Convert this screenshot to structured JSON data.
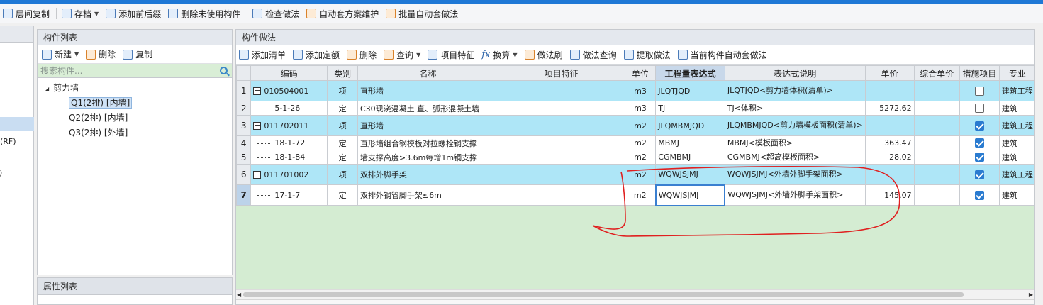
{
  "toolbar": {
    "items": [
      {
        "label": "层间复制",
        "icon": "copy-floor-icon"
      },
      {
        "label": "存档",
        "icon": "save-archive-icon",
        "dropdown": true
      },
      {
        "label": "添加前后缀",
        "icon": "add-affix-icon"
      },
      {
        "label": "删除未使用构件",
        "icon": "delete-unused-icon"
      },
      {
        "label": "检查做法",
        "icon": "check-method-icon"
      },
      {
        "label": "自动套方案维护",
        "icon": "auto-scheme-icon"
      },
      {
        "label": "批量自动套做法",
        "icon": "batch-auto-icon"
      }
    ]
  },
  "left_strip": {
    "fragment1": "(RF)",
    "fragment2": ")"
  },
  "component_list": {
    "title": "构件列表",
    "tools": {
      "new": "新建",
      "delete": "删除",
      "copy": "复制"
    },
    "search_placeholder": "搜索构件...",
    "tree": {
      "root": "剪力墙",
      "children": [
        "Q1(2排) [内墙]",
        "Q2(2排) [内墙]",
        "Q3(2排) [外墙]"
      ],
      "selected_index": 0
    }
  },
  "attribute_list": {
    "title": "属性列表"
  },
  "method_panel": {
    "title": "构件做法",
    "tools": {
      "add_list": "添加清单",
      "add_quota": "添加定额",
      "delete": "删除",
      "query": "查询",
      "item_feature": "项目特征",
      "fx": "fx",
      "convert": "换算",
      "brush": "做法刷",
      "method_query": "做法查询",
      "extract": "提取做法",
      "auto_apply": "当前构件自动套做法"
    },
    "columns": [
      "编码",
      "类别",
      "名称",
      "项目特征",
      "单位",
      "工程量表达式",
      "表达式说明",
      "单价",
      "综合单价",
      "措施项目",
      "专业"
    ],
    "active_column": "工程量表达式",
    "rows": [
      {
        "num": "1",
        "kind": "item",
        "code": "010504001",
        "cat": "项",
        "name": "直形墙",
        "feature": "",
        "unit": "m3",
        "expr": "JLQTJQD",
        "desc": "JLQTJQD<剪力墙体积(清单)>",
        "price": "",
        "comp_price": "",
        "measure": false,
        "major": "建筑工程"
      },
      {
        "num": "2",
        "kind": "sub",
        "code": "5-1-26",
        "cat": "定",
        "name": "C30现浇混凝土 直、弧形混凝土墙",
        "feature": "",
        "unit": "m3",
        "expr": "TJ",
        "desc": "TJ<体积>",
        "price": "5272.62",
        "comp_price": "",
        "measure": false,
        "major": "建筑"
      },
      {
        "num": "3",
        "kind": "item",
        "code": "011702011",
        "cat": "项",
        "name": "直形墙",
        "feature": "",
        "unit": "m2",
        "expr": "JLQMBMJQD",
        "desc": "JLQMBMJQD<剪力墙模板面积(清单)>",
        "price": "",
        "comp_price": "",
        "measure": true,
        "major": "建筑工程"
      },
      {
        "num": "4",
        "kind": "sub",
        "code": "18-1-72",
        "cat": "定",
        "name": "直形墙组合钢模板对拉螺栓钢支撑",
        "feature": "",
        "unit": "m2",
        "expr": "MBMJ",
        "desc": "MBMJ<模板面积>",
        "price": "363.47",
        "comp_price": "",
        "measure": true,
        "major": "建筑"
      },
      {
        "num": "5",
        "kind": "sub",
        "code": "18-1-84",
        "cat": "定",
        "name": "墙支撑高度>3.6m每增1m钢支撑",
        "feature": "",
        "unit": "m2",
        "expr": "CGMBMJ",
        "desc": "CGMBMJ<超高模板面积>",
        "price": "28.02",
        "comp_price": "",
        "measure": true,
        "major": "建筑"
      },
      {
        "num": "6",
        "kind": "item",
        "code": "011701002",
        "cat": "项",
        "name": "双排外脚手架",
        "feature": "",
        "unit": "m2",
        "expr": "WQWJSJMJ",
        "desc": "WQWJSJMJ<外墙外脚手架面积>",
        "price": "",
        "comp_price": "",
        "measure": true,
        "major": "建筑工程"
      },
      {
        "num": "7",
        "kind": "sub",
        "code": "17-1-7",
        "cat": "定",
        "name": "双排外钢管脚手架≤6m",
        "feature": "",
        "unit": "m2",
        "expr": "WQWJSJMJ",
        "desc": "WQWJSJMJ<外墙外脚手架面积>",
        "price": "145.07",
        "comp_price": "",
        "measure": true,
        "major": "建筑"
      }
    ],
    "current_row": "7"
  },
  "colors": {
    "accent": "#1e78d6",
    "item_row": "#aee6f7",
    "empty_area": "#d4ecd2",
    "annotation": "#e02020"
  }
}
